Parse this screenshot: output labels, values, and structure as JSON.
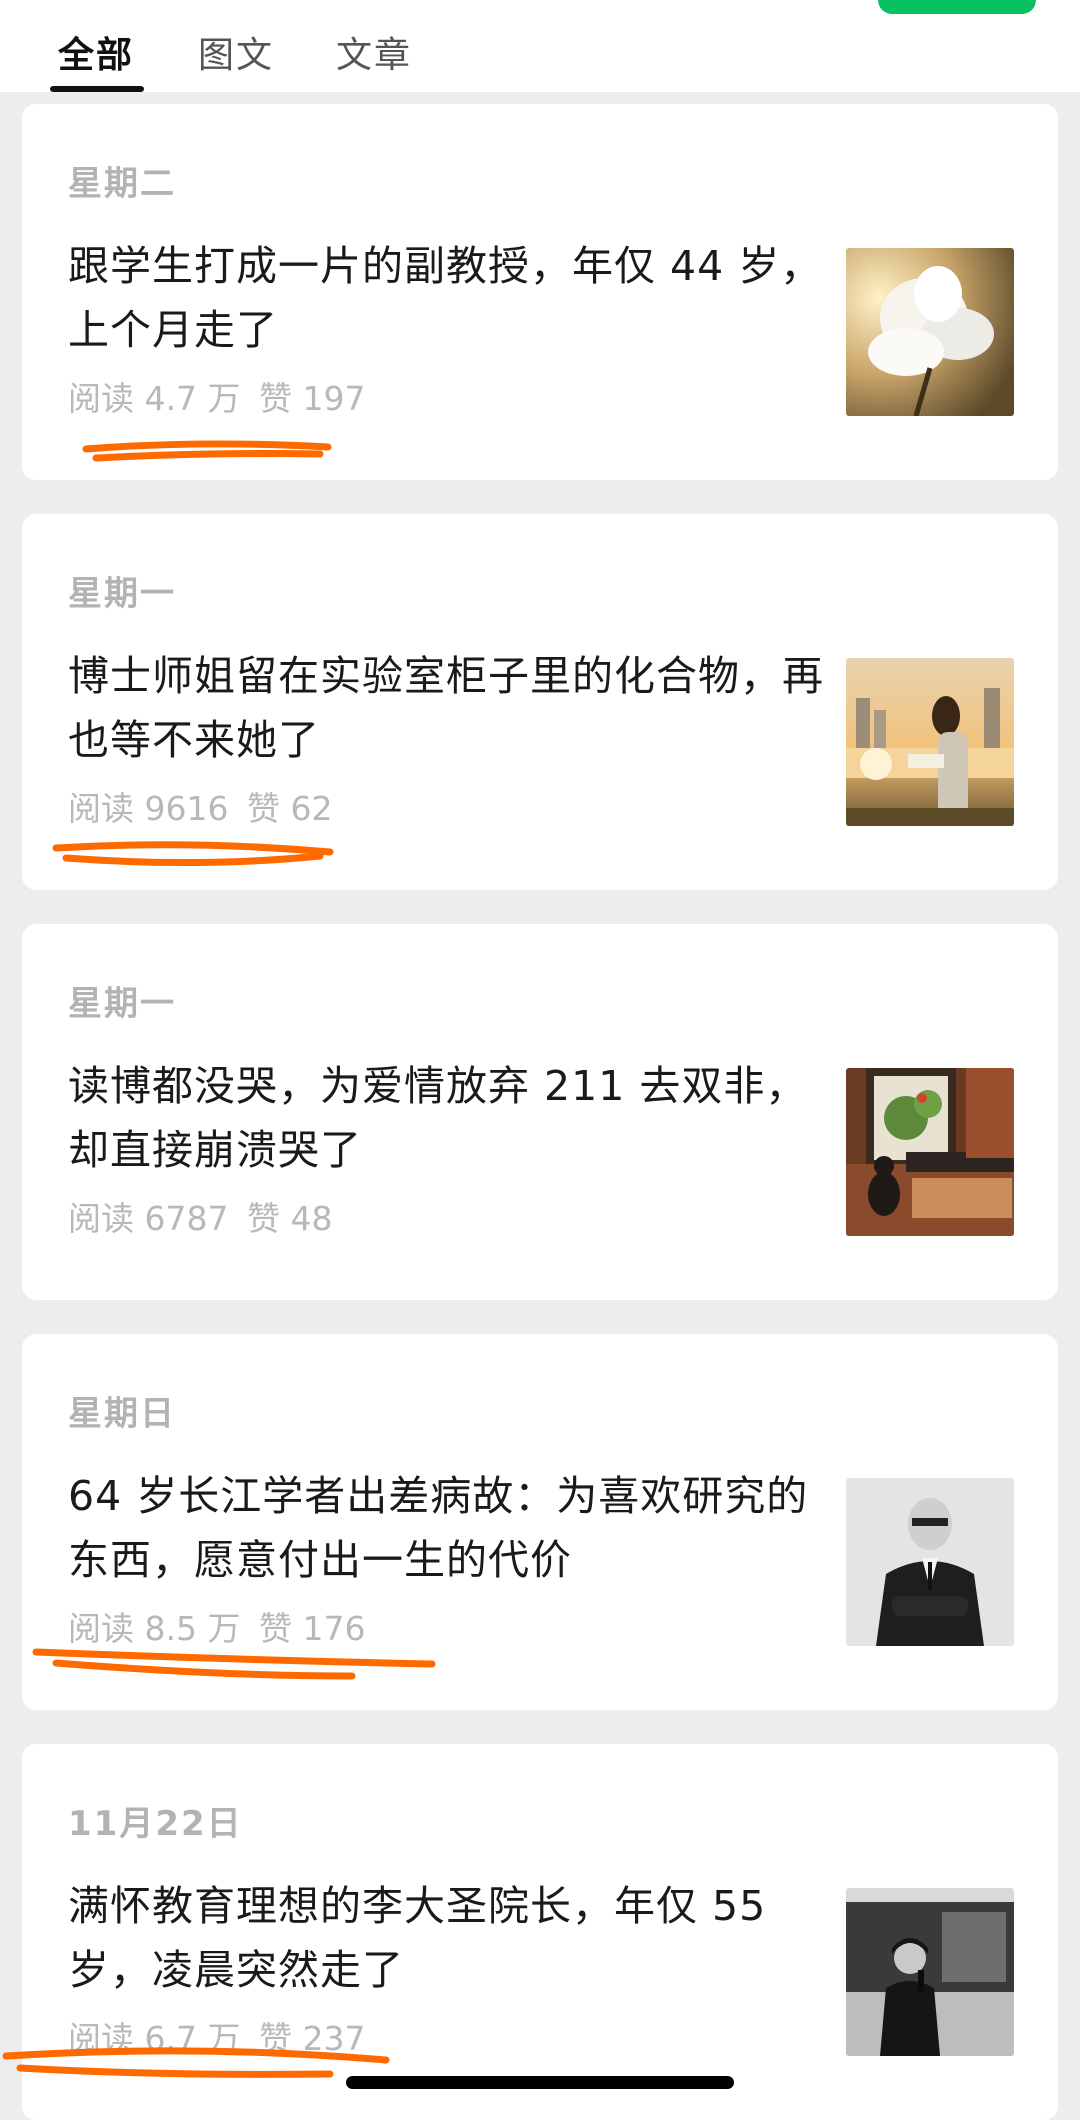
{
  "tabs": [
    {
      "label": "全部",
      "active": true
    },
    {
      "label": "图文",
      "active": false
    },
    {
      "label": "文章",
      "active": false
    }
  ],
  "articles": [
    {
      "date": "星期二",
      "title": "跟学生打成一片的副教授，年仅 44 岁，上个月走了",
      "reads": "阅读 4.7 万",
      "likes": "赞 197",
      "thumb_icon": "white-magnolia-flower"
    },
    {
      "date": "星期一",
      "title": "博士师姐留在实验室柜子里的化合物，再也等不来她了",
      "reads": "阅读 9616",
      "likes": "赞 62",
      "thumb_icon": "woman-reading-by-river"
    },
    {
      "date": "星期一",
      "title": "读博都没哭，为爱情放弃 211 去双非，却直接崩溃哭了",
      "reads": "阅读 6787",
      "likes": "赞 48",
      "thumb_icon": "cat-on-brick-wall"
    },
    {
      "date": "星期日",
      "title": "64 岁长江学者出差病故：为喜欢研究的东西，愿意付出一生的代价",
      "reads": "阅读 8.5 万",
      "likes": "赞 176",
      "thumb_icon": "man-in-suit-portrait"
    },
    {
      "date": "11月22日",
      "title": "满怀教育理想的李大圣院长，年仅 55 岁，凌晨突然走了",
      "reads": "阅读 6.7 万",
      "likes": "赞 237",
      "thumb_icon": "speaker-with-microphone"
    }
  ],
  "colors": {
    "accent_green": "#07c160",
    "annotation_orange": "#ff6a00",
    "background": "#ededed"
  }
}
